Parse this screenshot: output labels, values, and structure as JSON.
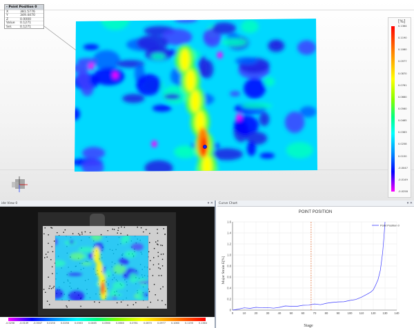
{
  "info_box": {
    "title": "- Point Position 0",
    "rows": [
      {
        "k": "X",
        "v": "381.5776"
      },
      {
        "k": "Y",
        "v": "349.4470"
      },
      {
        "k": "Z",
        "v": "0.0000"
      },
      {
        "k": "Value",
        "v": "0.1271"
      },
      {
        "k": "Sel.",
        "v": "0.1271"
      }
    ]
  },
  "legend": {
    "unit": "[%]",
    "labels": [
      "0.1364",
      "0.1190",
      "0.1060",
      "0.0977",
      "0.0870",
      "0.0761",
      "0.0660",
      "0.0560",
      "0.0465",
      "0.0363",
      "0.0258",
      "0.0150",
      "-0.0047",
      "-0.0149",
      "-0.0258"
    ]
  },
  "left_panel": {
    "title": "ide View 0",
    "colorbar_labels": [
      "-0.0258",
      "-0.0149",
      "-0.0047",
      "0.0150",
      "0.0258",
      "0.0363",
      "0.0465",
      "0.0560",
      "0.0660",
      "0.0761",
      "0.0870",
      "0.0977",
      "0.1060",
      "0.1190",
      "0.1364"
    ]
  },
  "right_panel": {
    "title": "Curve Chart",
    "window_icons": "▾ ✕"
  },
  "left_window_icons": "▾ ✕",
  "chart_data": {
    "type": "line",
    "title": "POINT POSITION",
    "xlabel": "Stage",
    "ylabel": "Major Strain E[%]",
    "xlim": [
      0,
      140
    ],
    "ylim": [
      0,
      1.6
    ],
    "xticks": [
      0,
      10,
      20,
      30,
      40,
      50,
      60,
      70,
      80,
      90,
      100,
      110,
      120,
      130,
      140
    ],
    "yticks": [
      0,
      0.2,
      0.4,
      0.6,
      0.8,
      1.0,
      1.2,
      1.4,
      1.6
    ],
    "legend_position": "top-right",
    "grid": true,
    "marker_line_x": 67,
    "series": [
      {
        "name": "Point Position 0",
        "color": "#3a3aff",
        "x": [
          0,
          5,
          10,
          15,
          20,
          25,
          30,
          35,
          40,
          45,
          50,
          55,
          60,
          65,
          70,
          75,
          80,
          85,
          90,
          95,
          100,
          105,
          110,
          115,
          118,
          120,
          122,
          124,
          126,
          127,
          128,
          129,
          130
        ],
        "y": [
          0.0,
          0.02,
          0.03,
          0.03,
          0.04,
          0.04,
          0.05,
          0.05,
          0.06,
          0.06,
          0.07,
          0.08,
          0.08,
          0.09,
          0.1,
          0.11,
          0.12,
          0.13,
          0.15,
          0.16,
          0.18,
          0.2,
          0.23,
          0.28,
          0.32,
          0.37,
          0.44,
          0.55,
          0.72,
          0.88,
          1.05,
          1.3,
          1.62
        ]
      }
    ]
  },
  "colors": {
    "accent": "#3a3aff",
    "marker_line": "#e06020",
    "panel_divider": "#9aa5b5"
  }
}
